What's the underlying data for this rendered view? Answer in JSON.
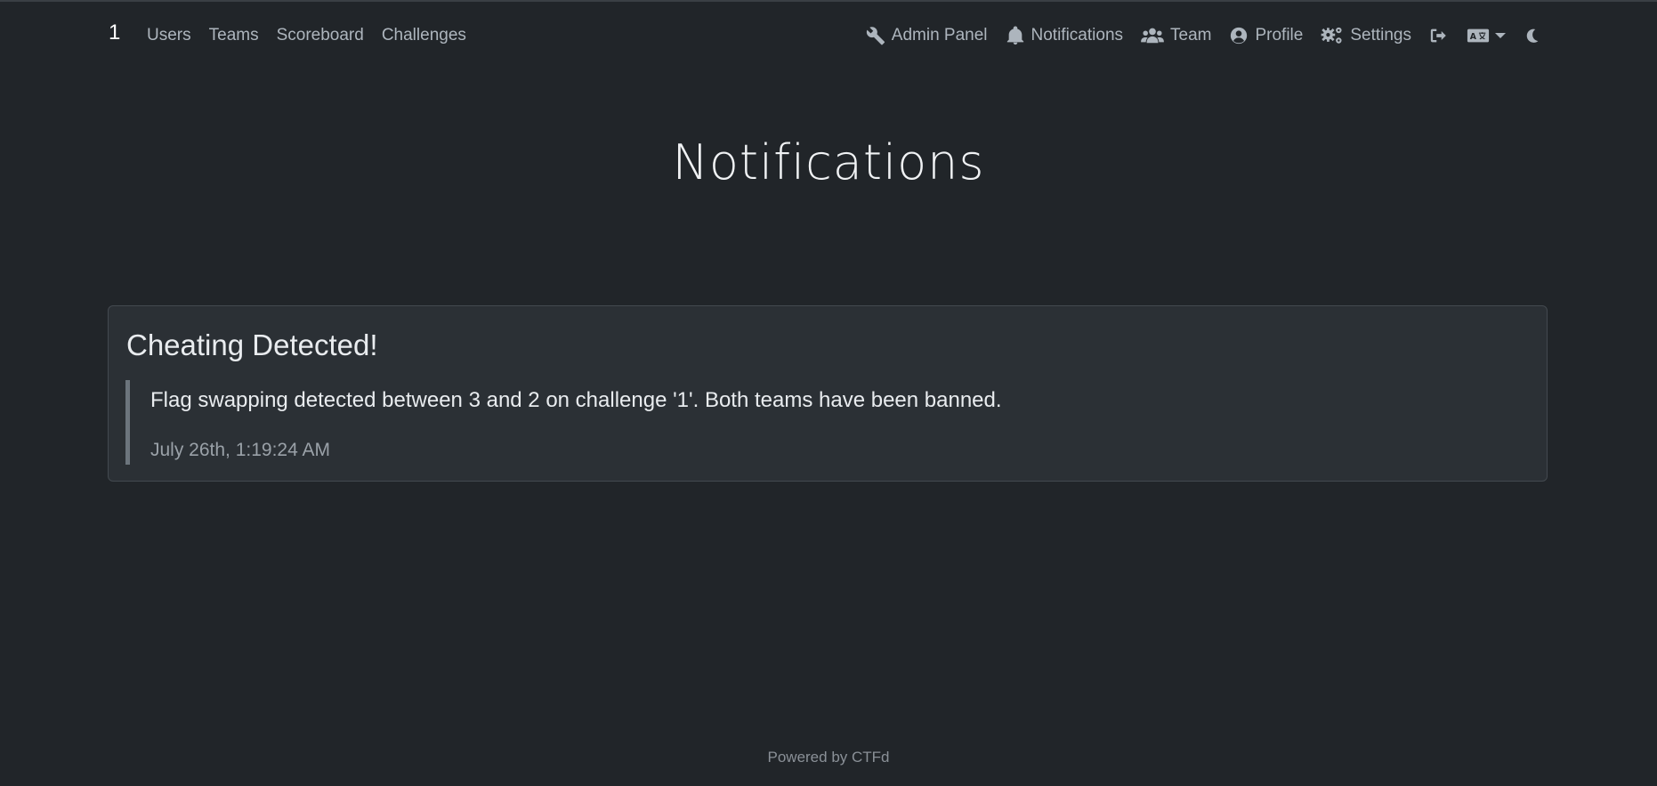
{
  "navbar": {
    "brand": "1",
    "left_links": [
      {
        "label": "Users"
      },
      {
        "label": "Teams"
      },
      {
        "label": "Scoreboard"
      },
      {
        "label": "Challenges"
      }
    ],
    "right_links": [
      {
        "label": "Admin Panel",
        "icon": "wrench-icon"
      },
      {
        "label": "Notifications",
        "icon": "bell-icon"
      },
      {
        "label": "Team",
        "icon": "users-icon"
      },
      {
        "label": "Profile",
        "icon": "user-circle-icon"
      },
      {
        "label": "Settings",
        "icon": "cogs-icon"
      }
    ],
    "logout_icon": "sign-out-icon",
    "language_icon": "language-icon",
    "theme_icon": "moon-icon"
  },
  "page": {
    "title": "Notifications"
  },
  "notifications": [
    {
      "title": "Cheating Detected!",
      "body": "Flag swapping detected between 3 and 2 on challenge '1'. Both teams have been banned.",
      "date": "July 26th, 1:19:24 AM"
    }
  ],
  "footer": {
    "text": "Powered by CTFd"
  },
  "colors": {
    "background": "#212529",
    "card": "#2b3035",
    "nav_text": "#adb5bd",
    "quote_border": "#6c757d"
  }
}
